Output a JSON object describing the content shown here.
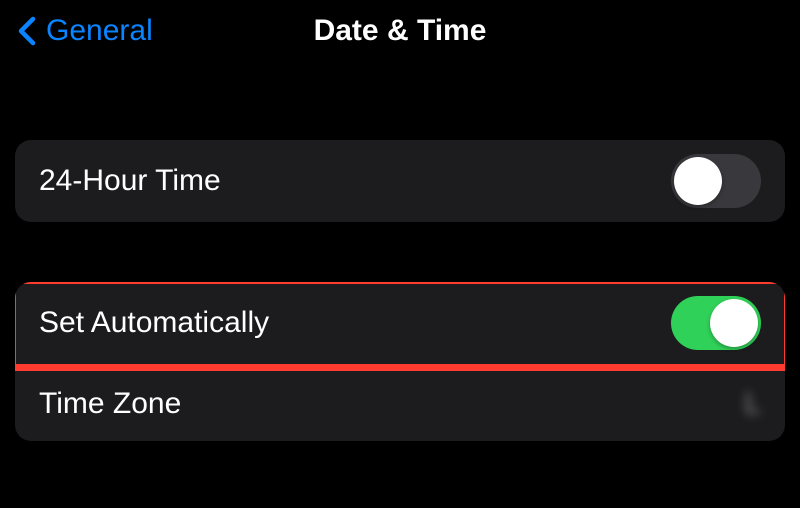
{
  "header": {
    "back_label": "General",
    "title": "Date & Time"
  },
  "group1": {
    "row1": {
      "label": "24-Hour Time",
      "toggle_state": "off"
    }
  },
  "group2": {
    "row1": {
      "label": "Set Automatically",
      "toggle_state": "on"
    },
    "row2": {
      "label": "Time Zone",
      "value": "L"
    }
  }
}
